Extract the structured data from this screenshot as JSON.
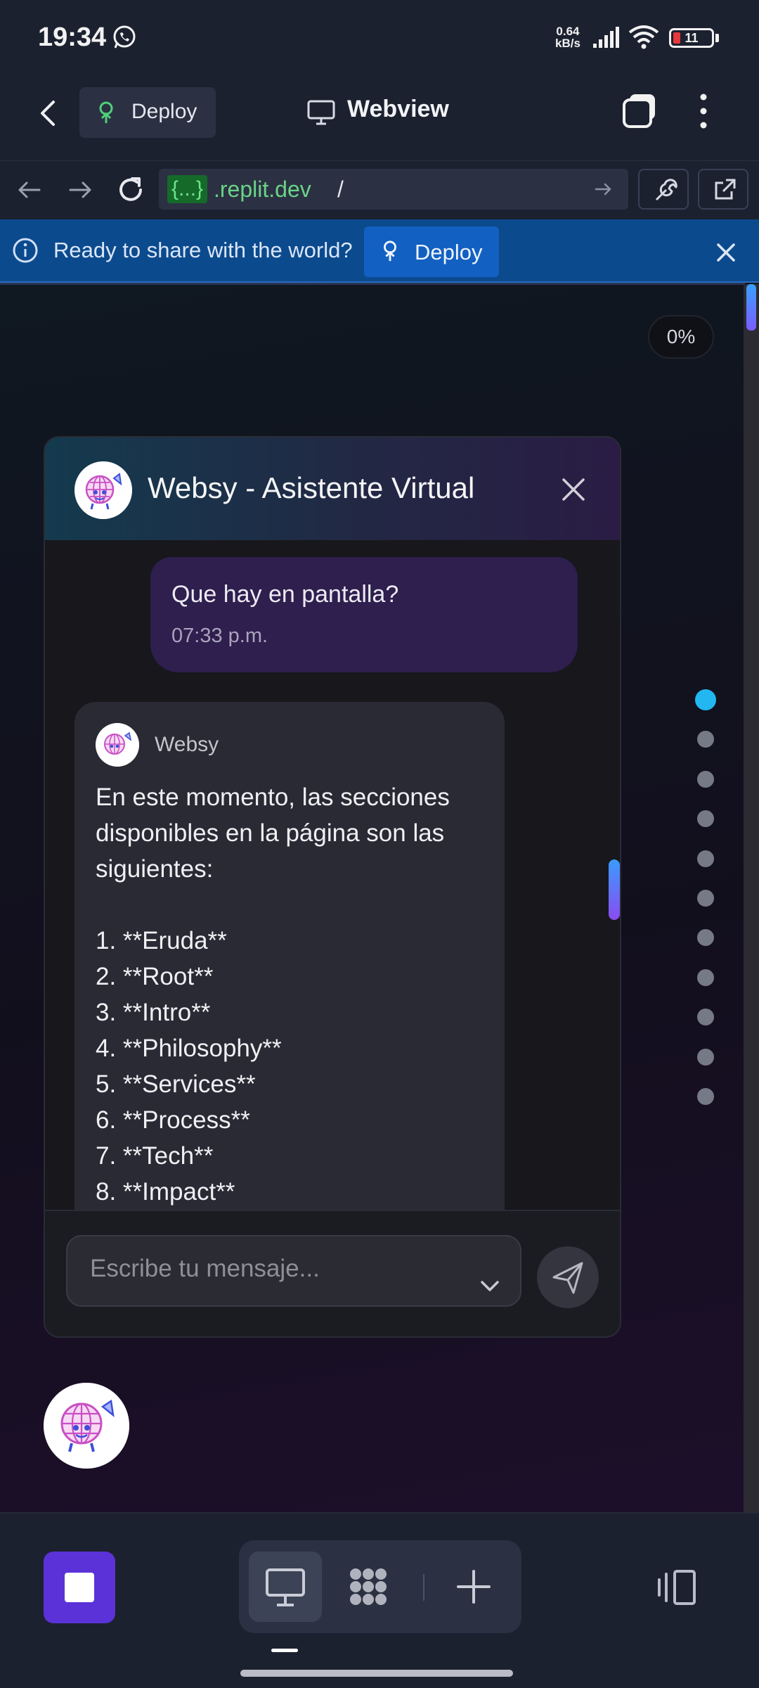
{
  "status_bar": {
    "time": "19:34",
    "net_speed_value": "0.64",
    "net_speed_unit": "kB/s",
    "battery": "11",
    "icons": [
      "whatsapp-icon",
      "signal-icon",
      "wifi-icon",
      "battery-icon"
    ]
  },
  "app_bar": {
    "deploy_label": "Deploy",
    "title": "Webview"
  },
  "url_bar": {
    "braces": "{...}",
    "domain": ".replit.dev",
    "path": "/"
  },
  "banner": {
    "text": "Ready to share with the world?",
    "deploy_label": "Deploy"
  },
  "page": {
    "progress": "0%",
    "section_dots": 11,
    "active_dot": 0
  },
  "chat": {
    "title": "Websy - Asistente Virtual",
    "user_message": {
      "text": "Que hay en pantalla?",
      "time": "07:33 p.m."
    },
    "bot_message": {
      "name": "Websy",
      "text": "En este momento, las secciones disponibles en la página son las siguientes:\n\n1. **Eruda**\n2. **Root**\n3. **Intro**\n4. **Philosophy**\n5. **Services**\n6. **Process**\n7. **Tech**\n8. **Impact**"
    },
    "input_placeholder": "Escribe tu mensaje..."
  },
  "colors": {
    "accent_purple": "#5a32d8",
    "banner_blue": "#0c4a8e",
    "active_dot": "#22b7f0"
  }
}
